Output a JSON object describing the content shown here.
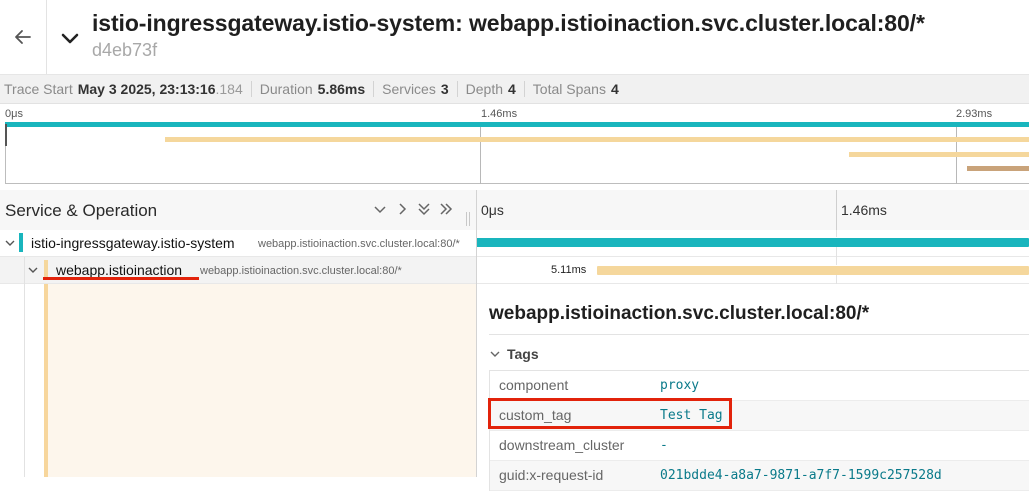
{
  "header": {
    "back_icon": "arrow-left-icon",
    "collapse_icon": "chevron-down-icon",
    "title": "istio-ingressgateway.istio-system: webapp.istioinaction.svc.cluster.local:80/*",
    "trace_id": "d4eb73f"
  },
  "summary": {
    "trace_start_label": "Trace Start",
    "trace_start_value": "May 3 2025, 23:13:16",
    "trace_start_ms": ".184",
    "duration_label": "Duration",
    "duration_value": "5.86ms",
    "services_label": "Services",
    "services_value": "3",
    "depth_label": "Depth",
    "depth_value": "4",
    "total_spans_label": "Total Spans",
    "total_spans_value": "4"
  },
  "minimap": {
    "ticks": [
      "0μs",
      "1.46ms",
      "2.93ms"
    ]
  },
  "table": {
    "service_operation_label": "Service & Operation",
    "controls": [
      "chevron-down-icon",
      "chevron-right-icon",
      "double-chevron-down-icon",
      "double-chevron-right-icon"
    ],
    "timeline_ticks": [
      "0μs",
      "1.46ms"
    ]
  },
  "spans": [
    {
      "service": "istio-ingressgateway.istio-system",
      "operation": "webapp.istioinaction.svc.cluster.local:80/*",
      "color": "#19b5bd"
    },
    {
      "service": "webapp.istioinaction",
      "operation": "webapp.istioinaction.svc.cluster.local:80/*",
      "duration": "5.11ms",
      "color": "#f5d79c"
    }
  ],
  "detail": {
    "title": "webapp.istioinaction.svc.cluster.local:80/*",
    "tags_label": "Tags",
    "tags": [
      {
        "key": "component",
        "value": "proxy"
      },
      {
        "key": "custom_tag",
        "value": "Test Tag"
      },
      {
        "key": "downstream_cluster",
        "value": "-"
      },
      {
        "key": "guid:x-request-id",
        "value": "021bdde4-a8a7-9871-a7f7-1599c257528d"
      }
    ]
  },
  "colors": {
    "accent_teal": "#19b5bd",
    "accent_tan": "#f5d79c",
    "accent_brown": "#c9a37a",
    "highlight_red": "#e2230b"
  }
}
